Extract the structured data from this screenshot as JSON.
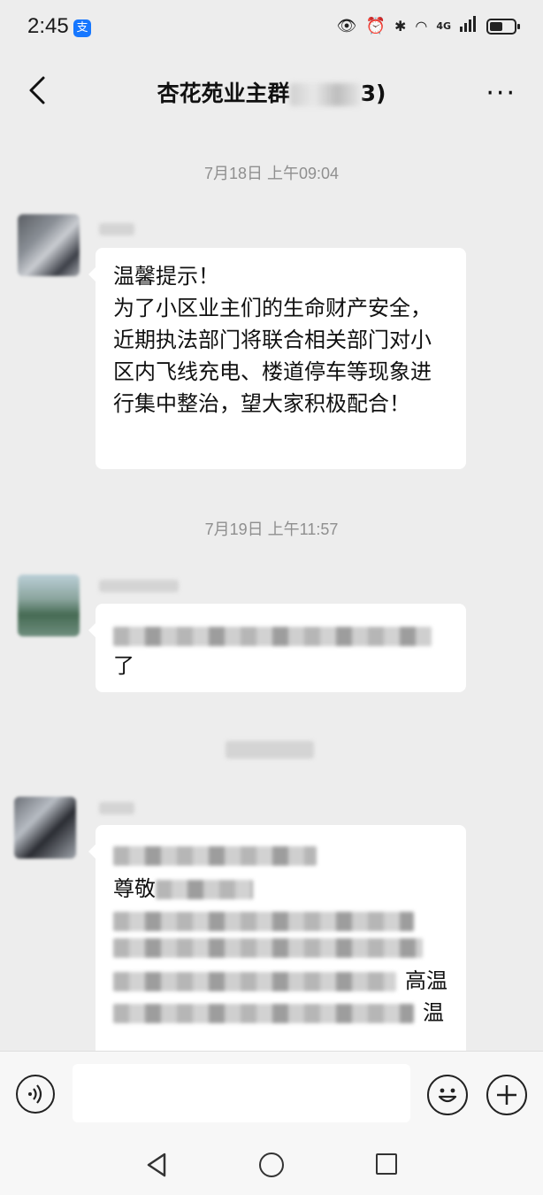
{
  "status_bar": {
    "time": "2:45",
    "alipay_icon": "支",
    "network": "4G"
  },
  "header": {
    "title_prefix": "杏花苑业主群",
    "title_suffix": "3)",
    "more_label": "···"
  },
  "messages": [
    {
      "timestamp": "7月18日 上午09:04",
      "text": "温馨提示！\n为了小区业主们的生命财产安全，近期执法部门将联合相关部门对小区内飞线充电、楼道停车等现象进行集中整治，望大家积极配合！"
    },
    {
      "timestamp": "7月19日 上午11:57",
      "text": "了"
    },
    {
      "timestamp": "",
      "fragments": [
        "尊敬",
        "高温",
        "温"
      ]
    }
  ],
  "icons": {
    "back": "chevron-left-icon",
    "more": "more-dots-icon",
    "voice": "voice-icon",
    "emoji": "emoji-icon",
    "plus": "plus-icon"
  }
}
